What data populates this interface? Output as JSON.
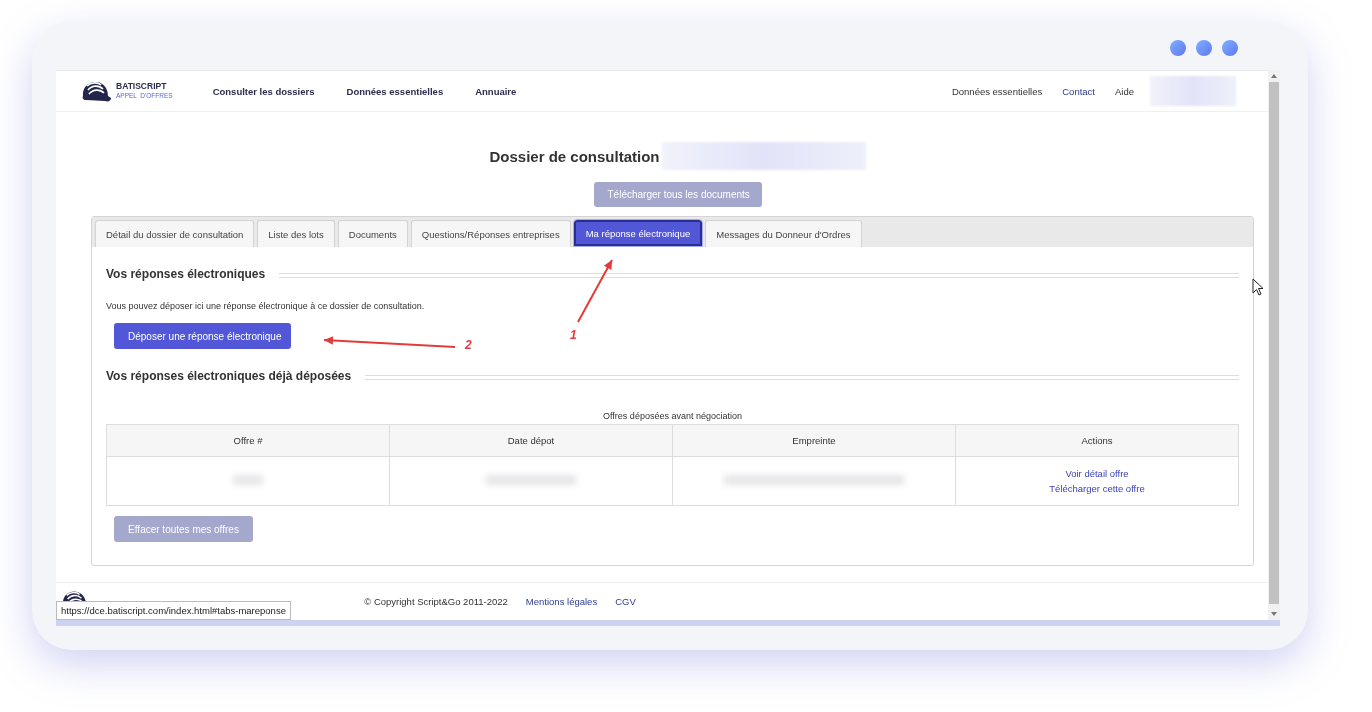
{
  "header": {
    "logo": {
      "name": "BATISCRIPT",
      "tagline": "APPEL  D'OFFRES"
    },
    "nav": [
      "Consulter les dossiers",
      "Données essentielles",
      "Annuaire"
    ],
    "right_links": [
      "Données essentielles",
      "Contact",
      "Aide"
    ]
  },
  "title": "Dossier de consultation",
  "download_button": {
    "label": "Télécharger tous les documents",
    "disabled": true
  },
  "tabs": [
    {
      "label": "Détail du dossier de consultation",
      "selected": false
    },
    {
      "label": "Liste des lots",
      "selected": false
    },
    {
      "label": "Documents",
      "selected": false
    },
    {
      "label": "Questions/Réponses entreprises",
      "selected": false
    },
    {
      "label": "Ma réponse électronique",
      "selected": true
    },
    {
      "label": "Messages du Donneur d'Ordres",
      "selected": false
    }
  ],
  "section_1": {
    "heading": "Vos réponses électroniques",
    "text": "Vous pouvez déposer ici une réponse électronique à ce dossier de consultation.",
    "button": {
      "label": "Déposer une réponse électronique",
      "disabled": false
    }
  },
  "section_2": {
    "heading": "Vos réponses électroniques déjà déposées",
    "table": {
      "caption": "Offres déposées avant négociation",
      "columns": [
        "Offre #",
        "Date dépot",
        "Empreinte",
        "Actions"
      ],
      "rows": [
        {
          "actions": [
            "Voir détail offre",
            "Télécharger cette offre"
          ]
        }
      ]
    },
    "button": {
      "label": "Effacer toutes mes offres",
      "disabled": true
    }
  },
  "annotations": [
    {
      "label": "1"
    },
    {
      "label": "2"
    }
  ],
  "footer": {
    "copyright": "© Copyright Script&Go 2011-2022",
    "links": [
      "Mentions légales",
      "CGV"
    ]
  },
  "status_url": "https://dce.batiscript.com/index.html#tabs-mareponse"
}
